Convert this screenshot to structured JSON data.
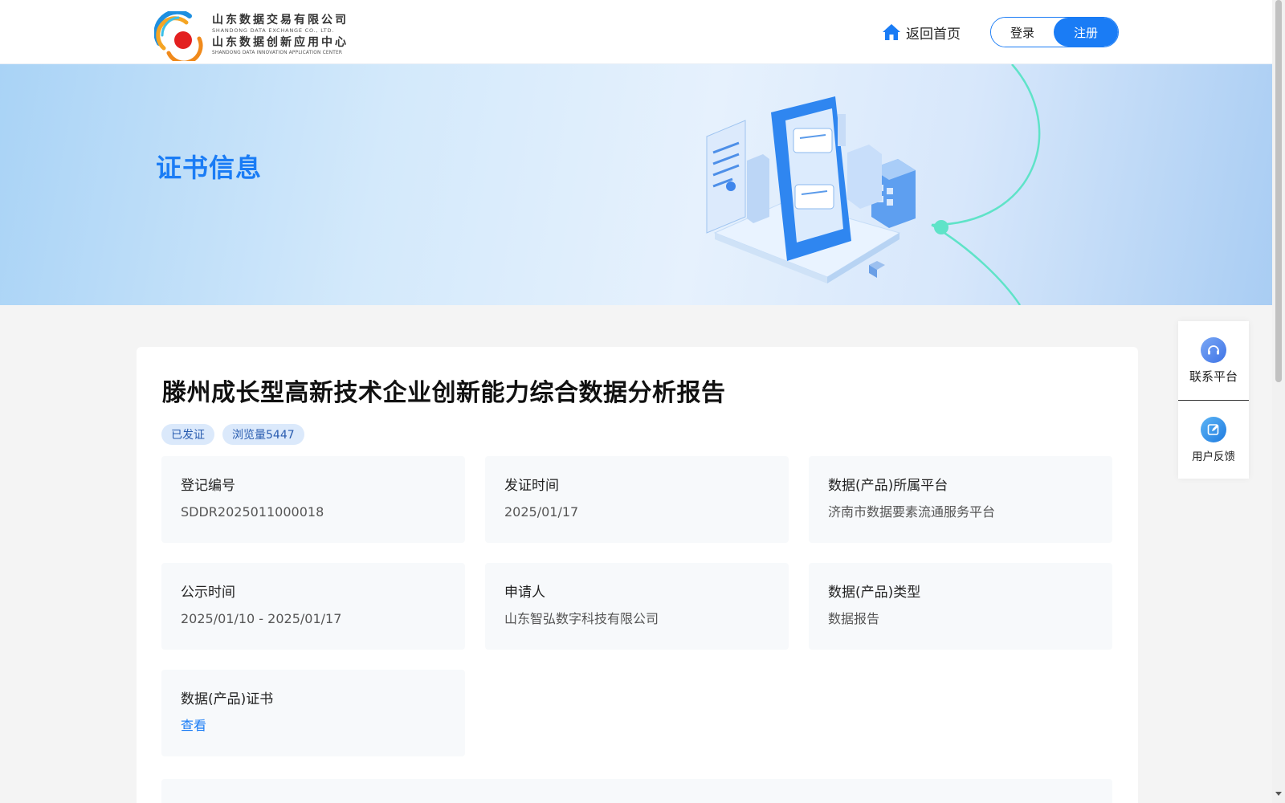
{
  "header": {
    "logo": {
      "line1": "山东数据交易有限公司",
      "sub1": "SHANDONG DATA EXCHANGE CO., LTD.",
      "line2": "山东数据创新应用中心",
      "sub2": "SHANDONG DATA INNOVATION APPLICATION CENTER"
    },
    "home_label": "返回首页",
    "login_label": "登录",
    "register_label": "注册"
  },
  "banner": {
    "title": "证书信息"
  },
  "float": {
    "contact_label": "联系平台",
    "feedback_label": "用户反馈"
  },
  "certificate": {
    "title": "滕州成长型高新技术企业创新能力综合数据分析报告",
    "tags": [
      "已发证",
      "浏览量5447"
    ],
    "fields": [
      {
        "label": "登记编号",
        "value": "SDDR2025011000018"
      },
      {
        "label": "发证时间",
        "value": "2025/01/17"
      },
      {
        "label": "数据(产品)所属平台",
        "value": "济南市数据要素流通服务平台"
      },
      {
        "label": "公示时间",
        "value": "2025/01/10 - 2025/01/17"
      },
      {
        "label": "申请人",
        "value": "山东智弘数字科技有限公司"
      },
      {
        "label": "数据(产品)类型",
        "value": "数据报告"
      },
      {
        "label": "数据(产品)证书",
        "value": "查看"
      }
    ]
  },
  "colors": {
    "accent": "#1a7cf5",
    "tag_bg": "#dbe9fb",
    "cell_bg": "#f7f9fb",
    "page_bg": "#f4f4f4"
  },
  "icons": {
    "home": "home-icon",
    "contact": "headset-icon",
    "feedback": "edit-icon"
  }
}
